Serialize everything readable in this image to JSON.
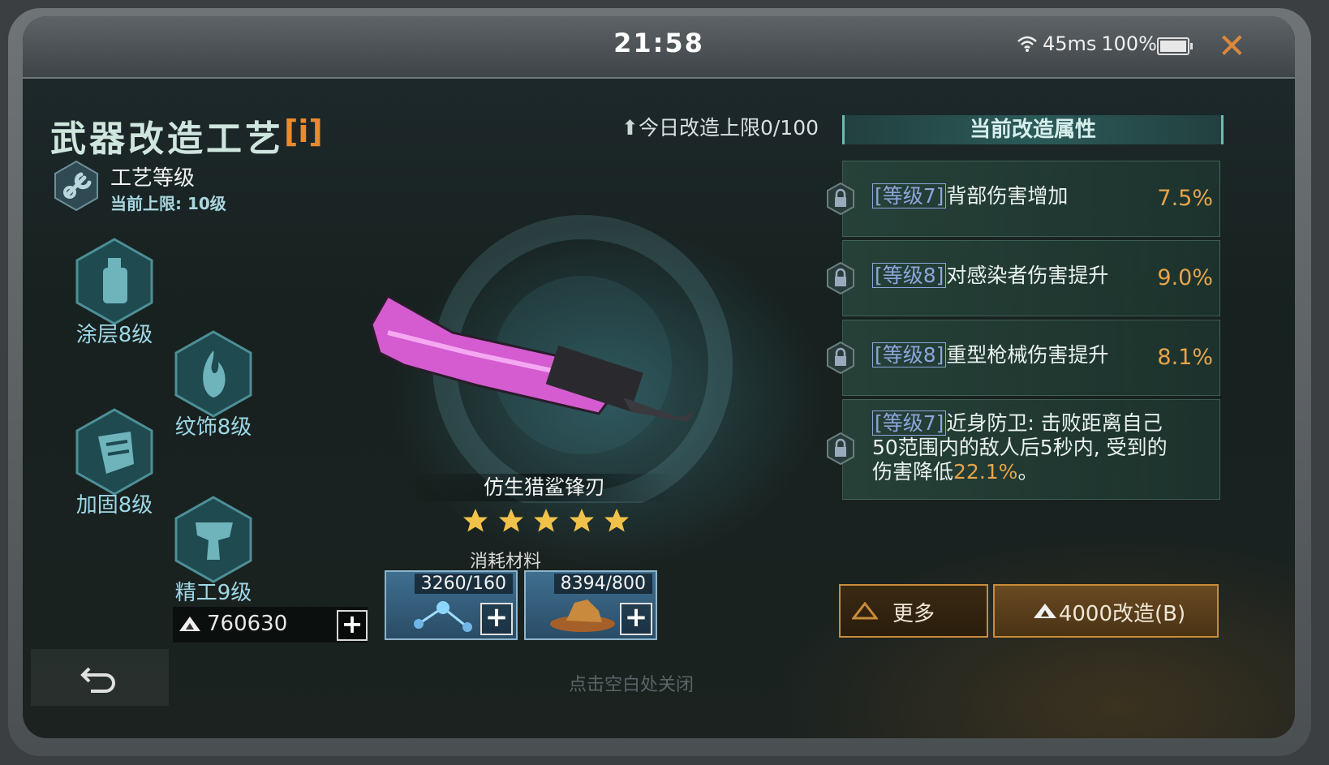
{
  "status_bar": {
    "time": "21:58",
    "ping": "45ms",
    "battery": "100%"
  },
  "title": "武器改造工艺",
  "info_button": "[i]",
  "craft": {
    "label": "工艺等级",
    "cap": "当前上限: 10级"
  },
  "mods": [
    {
      "label": "涂层8级",
      "icon": "spray-can-icon"
    },
    {
      "label": "纹饰8级",
      "icon": "flame-emblem-icon"
    },
    {
      "label": "加固8级",
      "icon": "armor-plate-icon"
    },
    {
      "label": "精工9级",
      "icon": "drill-icon"
    }
  ],
  "daily_limit": "今日改造上限0/100",
  "weapon": {
    "name": "仿生猎鲨锋刃",
    "stars": 5
  },
  "materials": {
    "title": "消耗材料",
    "items": [
      {
        "count": "3260/160",
        "icon": "molecule-icon"
      },
      {
        "count": "8394/800",
        "icon": "ore-pile-icon"
      }
    ]
  },
  "currency": {
    "value": "760630",
    "icon": "triangle-token-icon"
  },
  "hint": "点击空白处关闭",
  "panel": {
    "title": "当前改造属性",
    "attrs": [
      {
        "level": "[等级7]",
        "text": "背部伤害增加",
        "value": "7.5%"
      },
      {
        "level": "[等级8]",
        "text": "对感染者伤害提升",
        "value": "9.0%"
      },
      {
        "level": "[等级8]",
        "text": "重型枪械伤害提升",
        "value": "8.1%"
      },
      {
        "level": "[等级7]",
        "text1": "近身防卫: 击败距离自己",
        "text2": "50范围内的敌人后5秒内, 受到的",
        "text3": "伤害降低",
        "hl": "22.1%",
        "text4": "。"
      }
    ]
  },
  "buttons": {
    "more": "更多",
    "modify": "4000改造(B)"
  },
  "colors": {
    "accent_orange": "#e7a54a",
    "close_orange": "#d9883d",
    "level_blue": "#8ca6dc",
    "mod_label": "#9fd8e6"
  }
}
